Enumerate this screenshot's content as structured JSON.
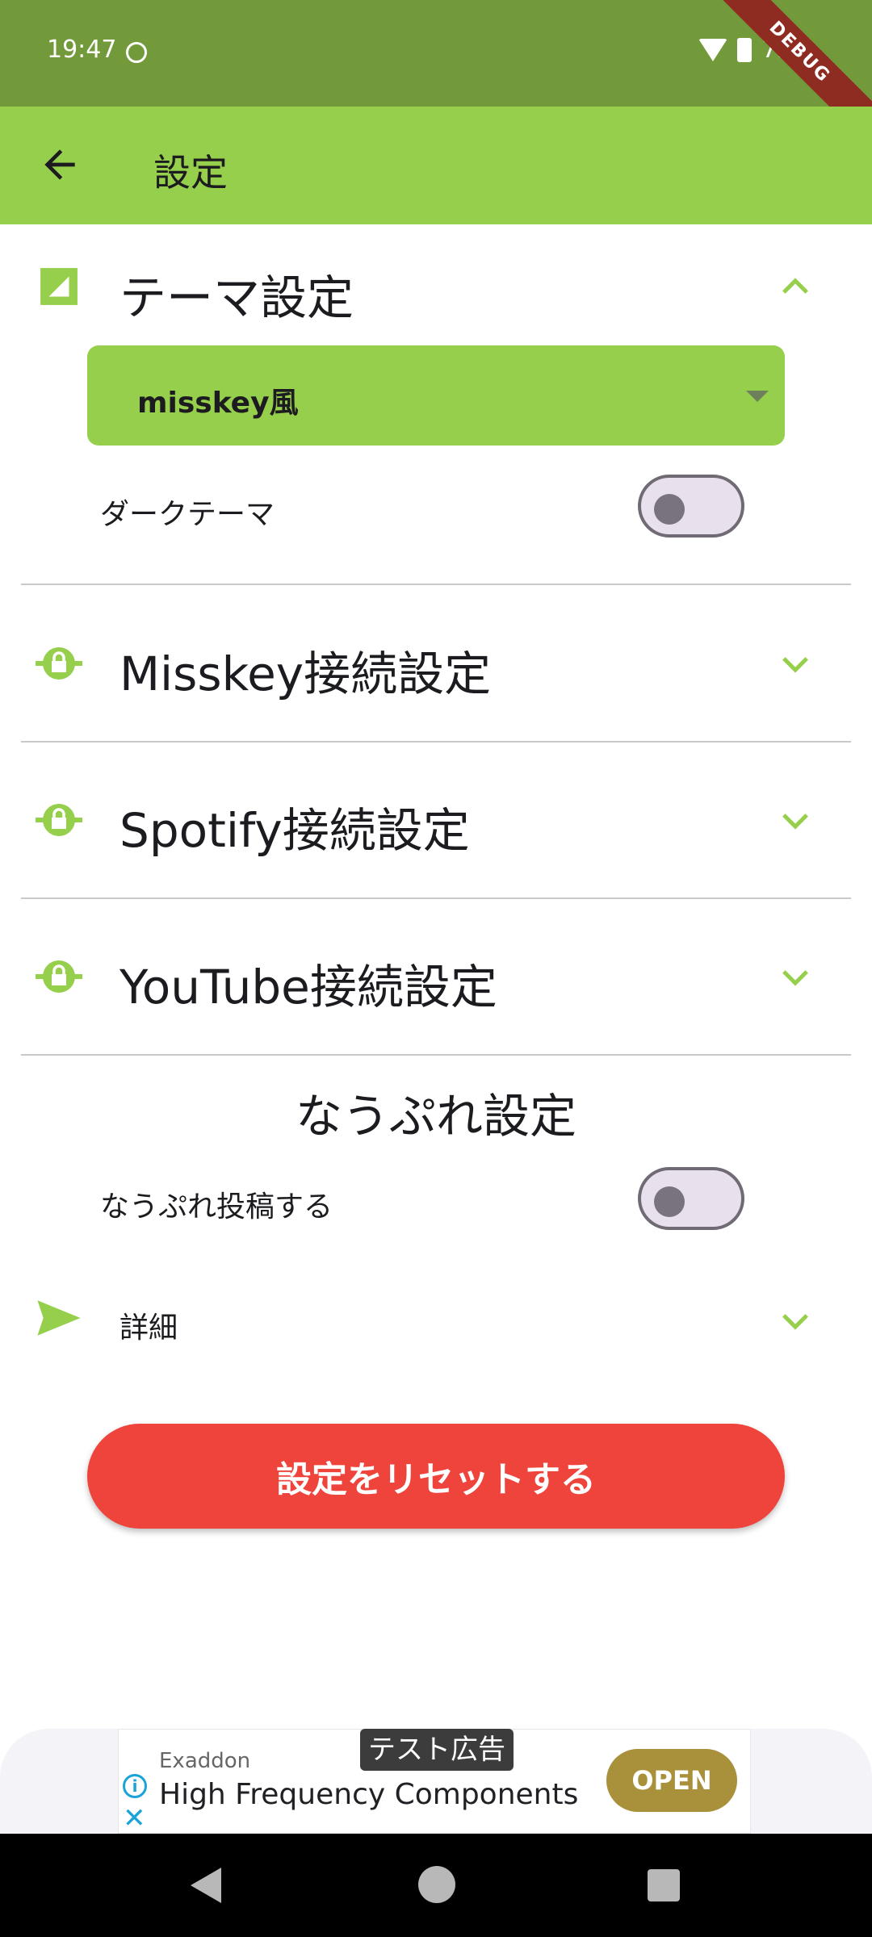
{
  "status_bar": {
    "time": "19:47",
    "battery": "73%"
  },
  "debug_banner": "DEBUG",
  "app_bar": {
    "title": "設定"
  },
  "sections": {
    "theme": {
      "title": "テーマ設定",
      "dropdown_value": "misskey風",
      "dark_theme_label": "ダークテーマ",
      "dark_theme_on": false
    },
    "misskey": {
      "title": "Misskey接続設定"
    },
    "spotify": {
      "title": "Spotify接続設定"
    },
    "youtube": {
      "title": "YouTube接続設定"
    }
  },
  "nowplaying": {
    "heading": "なうぷれ設定",
    "post_label": "なうぷれ投稿する",
    "post_on": false,
    "detail_label": "詳細"
  },
  "reset_button": "設定をリセットする",
  "ad": {
    "tag": "テスト広告",
    "advertiser": "Exaddon",
    "headline": "High Frequency Components",
    "cta": "OPEN"
  },
  "colors": {
    "status_bar": "#729a3a",
    "app_bar": "#95cf4c",
    "accent": "#95cf4c",
    "reset": "#ee443c"
  }
}
